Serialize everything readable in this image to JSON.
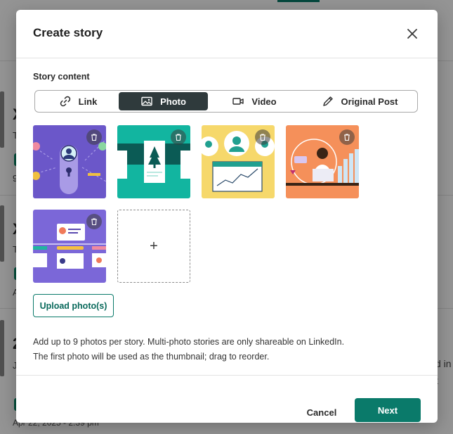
{
  "dialog": {
    "title": "Create story",
    "section_label": "Story content",
    "tabs": [
      {
        "label": "Link",
        "icon": "link-icon",
        "active": false
      },
      {
        "label": "Photo",
        "icon": "image-icon",
        "active": true
      },
      {
        "label": "Video",
        "icon": "video-icon",
        "active": false
      },
      {
        "label": "Original Post",
        "icon": "pen-icon",
        "active": false
      }
    ],
    "photos": [
      {
        "name": "photo-1",
        "background": "#6b57c9"
      },
      {
        "name": "photo-2",
        "background": "#12b5a0"
      },
      {
        "name": "photo-3",
        "background": "#f6d86b"
      },
      {
        "name": "photo-4",
        "background": "#f5905a"
      },
      {
        "name": "photo-5",
        "background": "#7b67d8"
      }
    ],
    "add_photo_symbol": "+",
    "upload_button": "Upload photo(s)",
    "help_lines": [
      "Add up to 9 photos per story. Multi-photo stories are only shareable on LinkedIn.",
      "The first photo will be used as the thumbnail; drag to reorder."
    ],
    "cancel_button": "Cancel",
    "next_button": "Next"
  },
  "background": {
    "row_letters": [
      "X",
      "X",
      "2"
    ],
    "row_snippets": [
      "T",
      "T",
      "J"
    ],
    "row_meta": [
      "9",
      "A"
    ],
    "right_fragment": "d in",
    "right_fragment_2": "t",
    "date_fragment": "Apr 22, 2025 - 2:39 pm"
  },
  "colors": {
    "accent": "#0a7a6a",
    "active_tab": "#2f3a3c"
  }
}
